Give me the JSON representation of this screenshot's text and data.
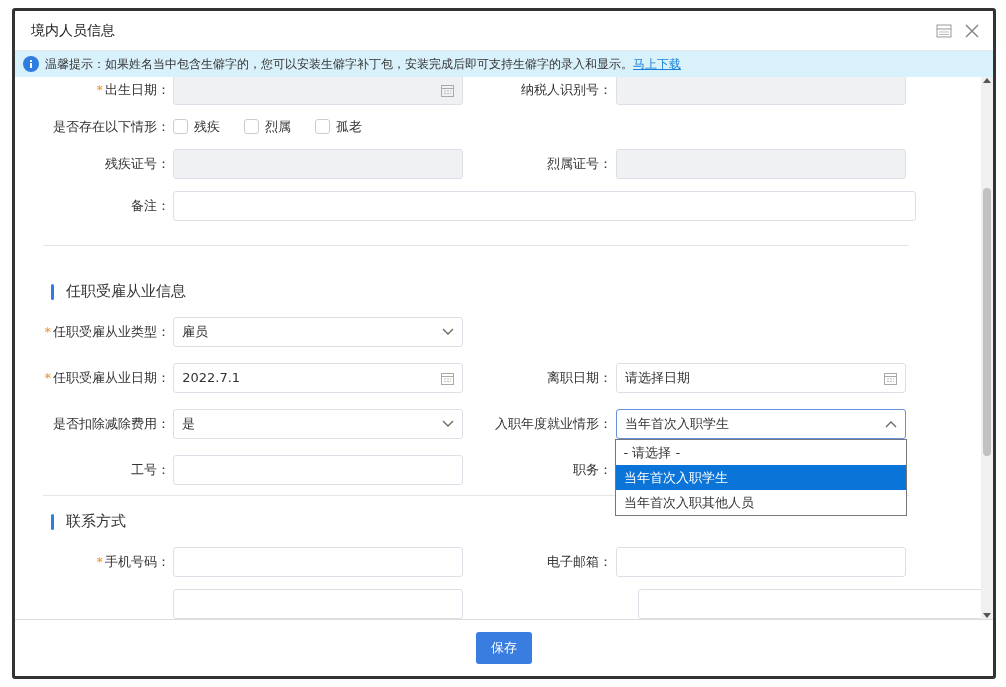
{
  "window": {
    "title": "境内人员信息"
  },
  "notice": {
    "text": "温馨提示：如果姓名当中包含生僻字的，您可以安装生僻字补丁包，安装完成后即可支持生僻字的录入和显示。",
    "link": "马上下载"
  },
  "sections": [
    {
      "rows": [
        [
          {
            "kind": "date",
            "label": "出生日期：",
            "marker": "*",
            "disabled": true
          },
          {
            "kind": "text",
            "label": "纳税人识别号：",
            "disabled": true
          }
        ],
        [
          {
            "kind": "checks",
            "label": "是否存在以下情形：",
            "options": [
              {
                "label": "残疾",
                "checked": false
              },
              {
                "label": "烈属",
                "checked": false
              },
              {
                "label": "孤老",
                "checked": false
              }
            ]
          }
        ],
        [
          {
            "kind": "text",
            "label": "残疾证号：",
            "disabled": true
          },
          {
            "kind": "text",
            "label": "烈属证号：",
            "disabled": true
          }
        ],
        [
          {
            "kind": "wide",
            "label": "备注：",
            "disabled": false
          }
        ]
      ]
    },
    {
      "title": "任职受雇从业信息",
      "rows": [
        [
          {
            "kind": "select",
            "label": "任职受雇从业类型：",
            "marker": "*",
            "value": "雇员",
            "expanded": false
          }
        ],
        [
          {
            "kind": "date",
            "label": "任职受雇从业日期：",
            "marker": "*",
            "disabled": false,
            "value": "2022.7.1"
          },
          {
            "kind": "date",
            "label": "离职日期：",
            "disabled": false,
            "placeholder": "请选择日期"
          }
        ],
        [
          {
            "kind": "select",
            "label": "是否扣除减除费用：",
            "value": "是",
            "expanded": false
          },
          {
            "kind": "select",
            "label": "入职年度就业情形：",
            "value": "当年首次入职学生",
            "expanded": true,
            "options": [
              {
                "label": "- 请选择 -",
                "selected": false
              },
              {
                "label": "当年首次入职学生",
                "selected": true
              },
              {
                "label": "当年首次入职其他人员",
                "selected": false
              }
            ]
          }
        ],
        [
          {
            "kind": "text",
            "label": "工号：",
            "disabled": false
          },
          {
            "kind": "text",
            "label": "职务：",
            "disabled": false
          }
        ]
      ]
    },
    {
      "title": "联系方式",
      "rows": [
        [
          {
            "kind": "text",
            "label": "手机号码：",
            "marker": "*",
            "disabled": false
          },
          {
            "kind": "text",
            "label": "电子邮箱：",
            "disabled": false
          }
        ],
        [
          {
            "kind": "text",
            "disabled": false
          },
          {
            "kind": "wide2",
            "disabled": false
          }
        ]
      ]
    }
  ],
  "footer": {
    "save": "保存"
  }
}
